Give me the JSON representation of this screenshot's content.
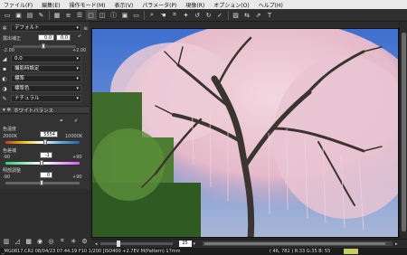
{
  "menu": [
    "ファイル(F)",
    "編集(E)",
    "操作モード(M)",
    "表示(V)",
    "パラメータ(P)",
    "現像(R)",
    "オプション(O)",
    "ヘルプ(H)"
  ],
  "panel": {
    "picture_style": "デフォルト",
    "brightness_label": "露出補正",
    "brightness_value": "0.0",
    "brightness_min": "-2.00",
    "brightness_max": "+2.00",
    "wb_value": "0.0",
    "sharpness_label": "撮影時設定",
    "color_space_label": "標準",
    "color_tone_label": "標準色",
    "natural_label": "ナチュラル",
    "wb_section": "ホワイトバランス",
    "color_temp_label": "色温度",
    "color_temp_value": "5554",
    "color_temp_min": "2000K",
    "color_temp_max": "10000K",
    "tint_label": "色差補",
    "tint_value": "-1",
    "tint_min": "-90",
    "tint_max": "+90",
    "exposure_label": "明部調整",
    "exposure_value": "0",
    "exposure_min": "-90",
    "exposure_max": "+90"
  },
  "zoom": {
    "value": "25",
    "label": "fit"
  },
  "status": {
    "text": "_MG0817.CR2  08/04/23 07:44:19  F10  1/200  [ISO400 +2.7EV M(Pattern)  17mm",
    "coords": "( 46, 782 )  R:33  G:35  B: 55"
  },
  "colors": {
    "accent_temp": "#3a7bd5",
    "badge": "#c8cc5a"
  }
}
